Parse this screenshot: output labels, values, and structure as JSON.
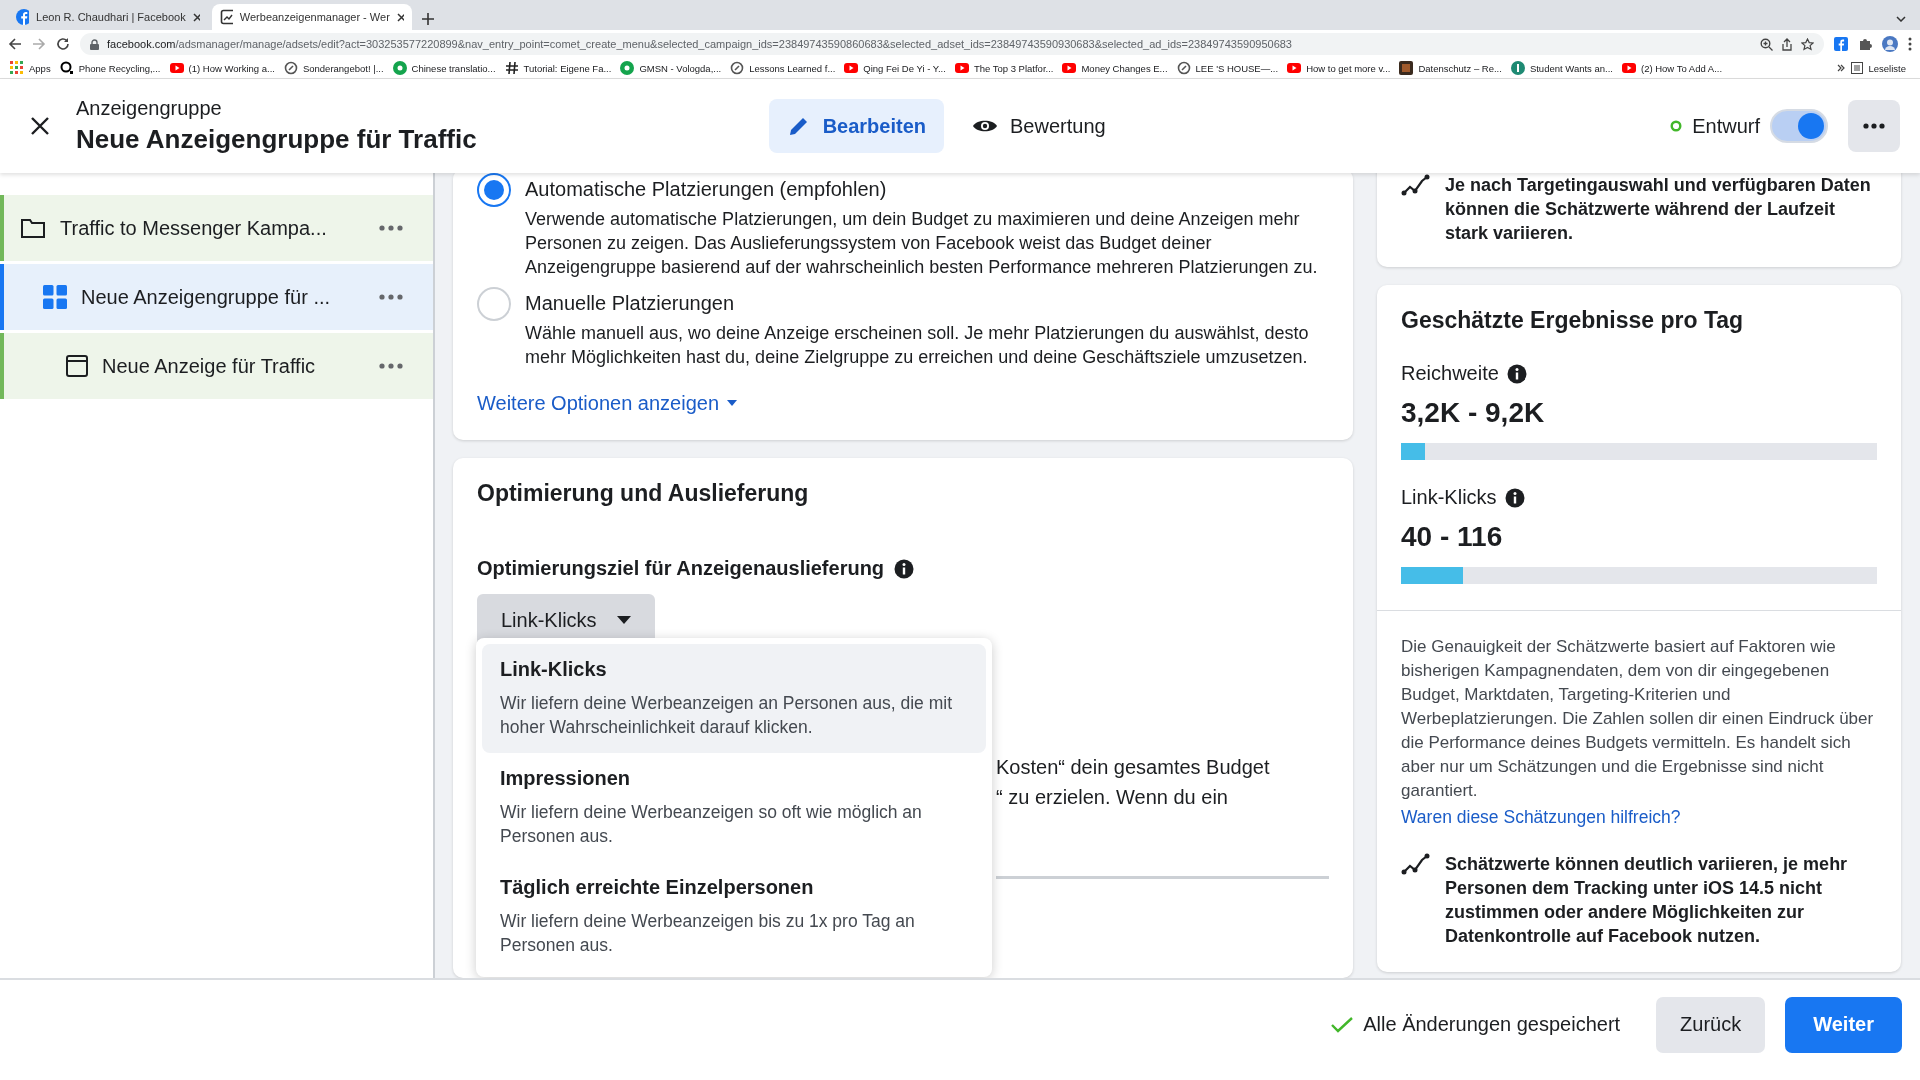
{
  "browser": {
    "tabs": [
      {
        "title": "Leon R. Chaudhari | Facebook",
        "kind": "facebook",
        "selected": false
      },
      {
        "title": "Werbeanzeigenmanager - Wer",
        "kind": "page",
        "selected": true
      }
    ],
    "url_host": "facebook.com",
    "url_path": "/adsmanager/manage/adsets/edit?act=303253577220899&nav_entry_point=comet_create_menu&selected_campaign_ids=23849743590860683&selected_adset_ids=23849743590930683&selected_ad_ids=23849743590950683",
    "bookmarks": [
      {
        "title": "Apps",
        "kind": "apps"
      },
      {
        "title": "Phone Recycling,...",
        "kind": "o2"
      },
      {
        "title": "(1) How Working a...",
        "kind": "video"
      },
      {
        "title": "Sonderangebot! |...",
        "kind": "ring"
      },
      {
        "title": "Chinese translatio...",
        "kind": "green"
      },
      {
        "title": "Tutorial: Eigene Fa...",
        "kind": "hash"
      },
      {
        "title": "GMSN - Vologda,...",
        "kind": "green"
      },
      {
        "title": "Lessons Learned f...",
        "kind": "ring"
      },
      {
        "title": "Qing Fei De Yi - Y...",
        "kind": "video"
      },
      {
        "title": "The Top 3 Platfor...",
        "kind": "video"
      },
      {
        "title": "Money Changes E...",
        "kind": "video"
      },
      {
        "title": "LEE 'S HOUSE—...",
        "kind": "ring"
      },
      {
        "title": "How to get more v...",
        "kind": "video"
      },
      {
        "title": "Datenschutz – Re...",
        "kind": "dark"
      },
      {
        "title": "Student Wants an...",
        "kind": "teal"
      },
      {
        "title": "(2) How To Add A...",
        "kind": "video"
      }
    ],
    "reading_list": "Leseliste"
  },
  "header": {
    "subtitle": "Anzeigengruppe",
    "title": "Neue Anzeigengruppe für Traffic",
    "modes": [
      {
        "label": "Bearbeiten",
        "kind": "pencil",
        "selected": true
      },
      {
        "label": "Bewertung",
        "kind": "eye",
        "selected": false
      }
    ],
    "status": "Entwurf",
    "toggle_on": true
  },
  "sidebar": {
    "items": [
      {
        "label": "Traffic to Messenger Kampa...",
        "kind": "campaign",
        "selected": false,
        "children": [
          {
            "label": "Neue Anzeigengruppe für ...",
            "kind": "adset",
            "selected": true,
            "children": [
              {
                "label": "Neue Anzeige für Traffic",
                "kind": "ad",
                "selected": false
              }
            ]
          }
        ]
      }
    ]
  },
  "placements": {
    "options": [
      {
        "title": "Automatische Platzierungen (empfohlen)",
        "selected": true,
        "description": "Verwende automatische Platzierungen, um dein Budget zu maximieren und deine Anzeigen mehr Personen zu zeigen. Das Auslieferungssystem von Facebook weist das Budget deiner Anzeigengruppe basierend auf der wahrscheinlich besten Performance mehreren Platzierungen zu."
      },
      {
        "title": "Manuelle Platzierungen",
        "selected": false,
        "description": "Wähle manuell aus, wo deine Anzeige erscheinen soll. Je mehr Platzierungen du auswählst, desto mehr Möglichkeiten hast du, deine Zielgruppe zu erreichen und deine Geschäftsziele umzusetzen."
      }
    ],
    "more_link": "Weitere Optionen anzeigen"
  },
  "optimization": {
    "title": "Optimierung und Auslieferung",
    "goal_label": "Optimierungsziel für Anzeigenauslieferung",
    "dropdown_value": "Link-Klicks",
    "menu": [
      {
        "title": "Link-Klicks",
        "description": "Wir liefern deine Werbeanzeigen an Personen aus, die mit hoher Wahrscheinlichkeit darauf klicken.",
        "selected": true
      },
      {
        "title": "Impressionen",
        "description": "Wir liefern deine Werbeanzeigen so oft wie möglich an Personen aus.",
        "selected": false
      },
      {
        "title": "Täglich erreichte Einzelpersonen",
        "description": "Wir liefern deine Werbeanzeigen bis zu 1x pro Tag an Personen aus.",
        "selected": false
      }
    ],
    "hidden_text": [
      "Kosten“ dein gesamtes Budget",
      "“ zu erzielen. Wenn du ein"
    ]
  },
  "estimates": {
    "top_note": "Je nach Targetingauswahl und verfügbaren Daten können die Schätzwerte während der Laufzeit stark variieren.",
    "title": "Geschätzte Ergebnisse pro Tag",
    "metrics": [
      {
        "label": "Reichweite",
        "value": "3,2K - 9,2K",
        "level": 0.05
      },
      {
        "label": "Link-Klicks",
        "value": "40 - 116",
        "level": 0.13
      }
    ],
    "disclaimer": "Die Genauigkeit der Schätzwerte basiert auf Faktoren wie bisherigen Kampagnendaten, dem von dir eingegebenen Budget, Marktdaten, Targeting-Kriterien und Werbeplatzierungen. Die Zahlen sollen dir einen Eindruck über die Performance deines Budgets vermitteln. Es handelt sich aber nur um Schätzungen und die Ergebnisse sind nicht garantiert.",
    "feedback_link": "Waren diese Schätzungen hilfreich?",
    "ios_note": "Schätzwerte können deutlich variieren, je mehr Personen dem Tracking unter iOS 14.5 nicht zustimmen oder andere Möglichkeiten zur Datenkontrolle auf Facebook nutzen."
  },
  "footer": {
    "saved": "Alle Änderungen gespeichert",
    "buttons": [
      {
        "label": "Zurück",
        "kind": "secondary"
      },
      {
        "label": "Weiter",
        "kind": "primary"
      }
    ]
  }
}
